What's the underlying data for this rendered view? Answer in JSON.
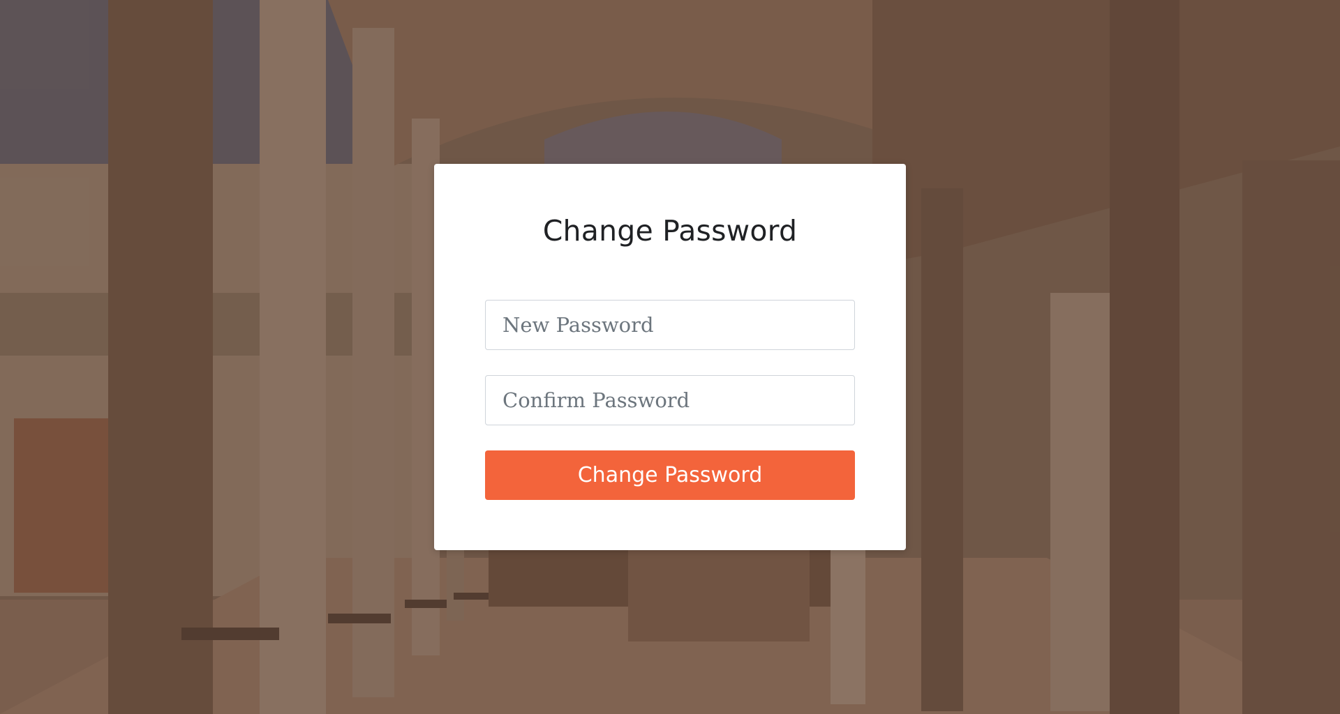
{
  "form": {
    "title": "Change Password",
    "new_password_placeholder": "New Password",
    "confirm_password_placeholder": "Confirm Password",
    "submit_label": "Change Password"
  },
  "colors": {
    "accent": "#f3643b",
    "card_background": "#ffffff",
    "input_border": "#cfd4da"
  }
}
